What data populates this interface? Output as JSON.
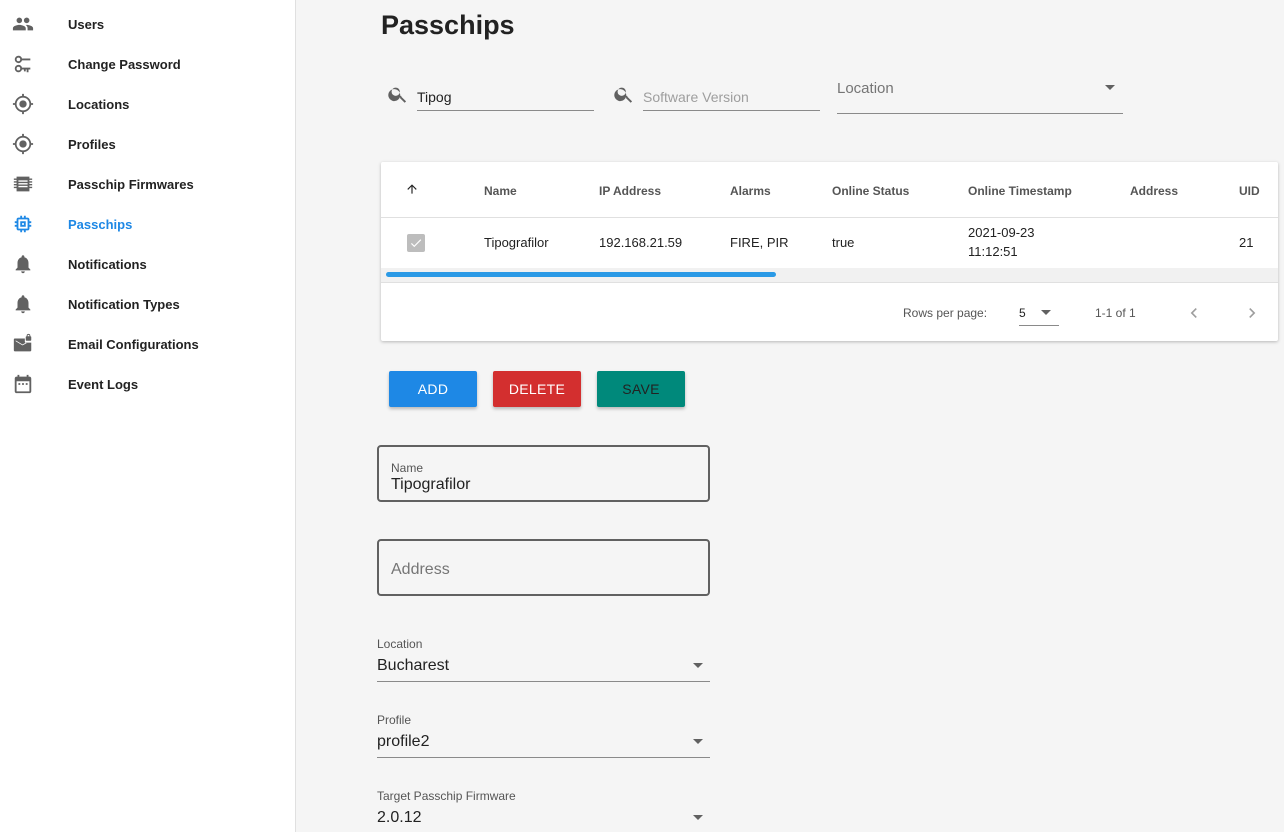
{
  "sidebar": {
    "items": [
      {
        "label": "Users",
        "icon": "users-icon"
      },
      {
        "label": "Change Password",
        "icon": "key-icon"
      },
      {
        "label": "Locations",
        "icon": "location-target-icon"
      },
      {
        "label": "Profiles",
        "icon": "location-target-icon"
      },
      {
        "label": "Passchip Firmwares",
        "icon": "firmware-chip-icon"
      },
      {
        "label": "Passchips",
        "icon": "memory-chip-icon",
        "active": true
      },
      {
        "label": "Notifications",
        "icon": "bell-icon"
      },
      {
        "label": "Notification Types",
        "icon": "bell-icon"
      },
      {
        "label": "Email Configurations",
        "icon": "email-lock-icon"
      },
      {
        "label": "Event Logs",
        "icon": "calendar-icon"
      }
    ]
  },
  "page": {
    "title": "Passchips"
  },
  "filters": {
    "name_value": "Tipog",
    "software_version_placeholder": "Software Version",
    "location_placeholder": "Location"
  },
  "table": {
    "columns": [
      "Name",
      "IP Address",
      "Alarms",
      "Online Status",
      "Online Timestamp",
      "Address",
      "UID"
    ],
    "rows": [
      {
        "selected": true,
        "name": "Tipografilor",
        "ip": "192.168.21.59",
        "alarms": "FIRE, PIR",
        "online_status": "true",
        "timestamp_date": "2021-09-23",
        "timestamp_time": "11:12:51",
        "address": "",
        "uid": "21"
      }
    ],
    "rows_per_page_label": "Rows per page:",
    "rows_per_page_value": "5",
    "range_label": "1-1 of 1"
  },
  "actions": {
    "add": "ADD",
    "delete": "DELETE",
    "save": "SAVE"
  },
  "colors": {
    "primary": "#1e88e5",
    "danger": "#d32f2f",
    "success": "#00897b"
  },
  "form": {
    "name_label": "Name",
    "name_value": "Tipografilor",
    "address_placeholder": "Address",
    "location_label": "Location",
    "location_value": "Bucharest",
    "profile_label": "Profile",
    "profile_value": "profile2",
    "firmware_label": "Target Passchip Firmware",
    "firmware_value": "2.0.12"
  }
}
